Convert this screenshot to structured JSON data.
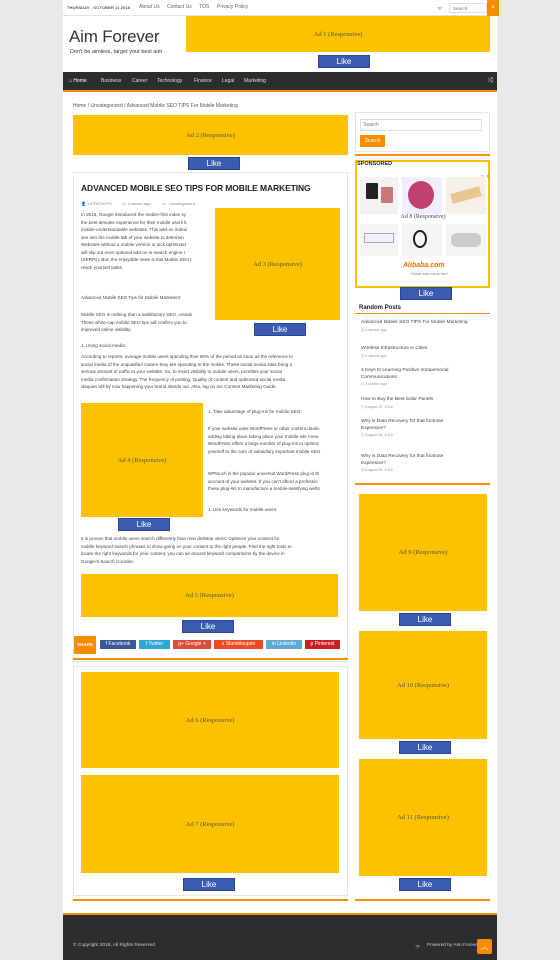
{
  "topbar": {
    "date": "THURSDAY , OCTOBER 11 2018",
    "links": [
      "About Us",
      "Contact Us",
      "TOS",
      "Privacy Policy"
    ],
    "search_placeholder": "Search"
  },
  "site": {
    "title": "Aim Forever",
    "tagline": "Don't be aimless, target your best aim"
  },
  "nav": {
    "items": [
      "Home",
      "Business",
      "Career",
      "Technology",
      "Finance",
      "Legal",
      "Marketing"
    ]
  },
  "ads": {
    "ad1": "Ad 1 (Responsive)",
    "ad2": "Ad 2 (Responsive)",
    "ad3": "Ad 3 (Responsive)",
    "ad4": "Ad 4 (Responsive)",
    "ad5": "Ad 5 (Responsive)",
    "ad6": "Ad 6 (Responsive)",
    "ad7": "Ad 7 (Responsive)",
    "ad8": "Ad 8 (Responsive)",
    "ad9": "Ad 9 (Responsive)",
    "ad10": "Ad 10 (Responsive)",
    "ad11": "Ad 11 (Responsive)",
    "like_label": "Like"
  },
  "breadcrumb": {
    "home": "Home",
    "sep": "/",
    "category": "Uncategorized",
    "current": "Advanced Mobile SEO TIPS For Mobile Marketing"
  },
  "post": {
    "title": "ADVANCED MOBILE SEO TIPS FOR MOBILE MARKETING",
    "author": "UCPAThCPH",
    "time": "4 weeks ago",
    "category": "Uncategorized",
    "p1": [
      "In 2016, Google introduced the mobile-first index sy",
      "the best devotee experience for their mobile users b",
      "mobile-understandable websites. This add-on indexi",
      "see into the mobile tab of your website to determin",
      "Websites without a mobile version or sick optimized",
      "will slip out even optional add-on in search engine r",
      "(SERPs). But, the enjoyable news is this Mobile SEO t",
      "reach yourself tasks."
    ],
    "p2": "Advanced Mobile SEO Tips for Mobile Marketers:",
    "p3": [
      "Mobile SEO is nothing than a satisfactory SEO, creatin",
      "These white-cap mobile SEO tips will confirm you to",
      "improved online visibility."
    ],
    "p4": "1. Using social media:",
    "p5": [
      "According to reports, average mobile users spending their 80% of the period as soon as the reference to",
      "social media of the unqualified mature they are spending re the mobile. These social media sites bring a",
      "serious amount of traffic to your website. So, to insert visibility to mobile users, priorities your social",
      "media confirmation strategy. The frequency of posting, Quality of content and optimized social media",
      "disquiet will by now happening your brand stands out. Also, log on our Content Marketing Guide."
    ],
    "p6": "1. Take advantage of plug-ins for mobile SEO:",
    "p7": [
      "If your website uses WordPress or other content dealin",
      "adding taking place taking place your mobile site more",
      "WordPress offers a large number of plug-ins to optimiz",
      "yourself to the care of subsidiary important mobile SEO"
    ],
    "p8": [
      "WPtouch is the popular universal WordPress plug-in th",
      "account of your website. If you can't afford a professio",
      "these plug-ins to manufacture a mobile-satisfying webs"
    ],
    "p9": "1. Use keywords for mobile users:",
    "p10": [
      "It is proven that mobile users search differently than new desktop users. Optimize your content for",
      "mobile keyword search phrases to show going on your content to the right people. Find the right tools to",
      "locate the right keywords for your content, you can air around keyword comparisons by the device in",
      "Google's Search Console."
    ]
  },
  "share": {
    "label": "SHARE",
    "buttons": [
      {
        "label": "Facebook",
        "color": "#3b5998"
      },
      {
        "label": "Twitter",
        "color": "#2fa6d9"
      },
      {
        "label": "Google +",
        "color": "#dd4b39"
      },
      {
        "label": "Stumbleupon",
        "color": "#e94b24"
      },
      {
        "label": "LinkedIn",
        "color": "#5fa8d3"
      },
      {
        "label": "Pinterest",
        "color": "#cb2027"
      }
    ]
  },
  "sidebar": {
    "search_placeholder": "Search",
    "search_button": "Search",
    "sponsored_title": "SPONSORED",
    "sponsor_brand": "Alibaba.com",
    "sponsor_sub": "Global trade starts here",
    "random_title": "Random Posts",
    "random_posts": [
      {
        "title": [
          "Advanced Mobile SEO TIPS For Mobile Marketing"
        ],
        "date": "4 weeks ago"
      },
      {
        "title": [
          "Wireless Infrastructure in Cities"
        ],
        "date": "4 weeks ago"
      },
      {
        "title": [
          "3 Keys to Learning Positive Intrapersonal",
          "Communications"
        ],
        "date": "4 weeks ago"
      },
      {
        "title": [
          "How to Buy the Best Solar Panels"
        ],
        "date": "August 26, 2018"
      },
      {
        "title": [
          "Why is Data Recovery for that footnote",
          "Expensive?"
        ],
        "date": "August 26, 2018"
      },
      {
        "title": [
          "Why is Data Recovery for that footnote",
          "Expensive?"
        ],
        "date": "August 26, 2018"
      }
    ]
  },
  "footer": {
    "copyright": "© Copyright 2018, All Rights Reserved",
    "powered": "Powered by Aim Forever"
  },
  "colors": {
    "accent": "#f88c00",
    "ad": "#fcc200",
    "like": "#3b5bb0",
    "nav": "#2d2d2d"
  }
}
